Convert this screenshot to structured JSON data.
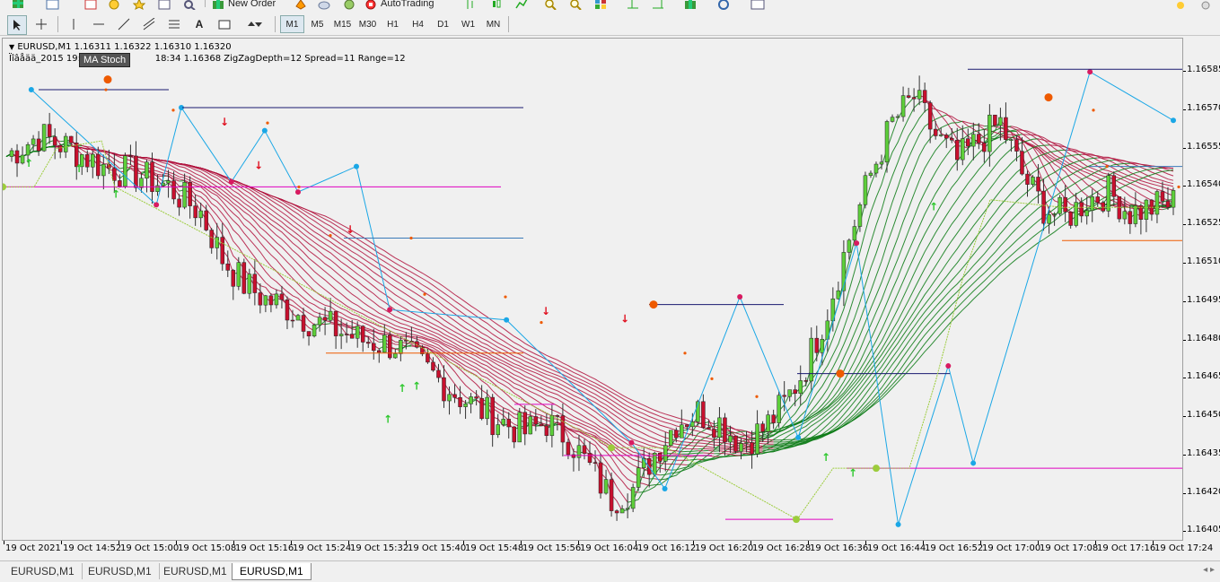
{
  "toolbar": {
    "new_order": "New Order",
    "auto_trading": "AutoTrading",
    "timeframes": [
      "M1",
      "M5",
      "M15",
      "M30",
      "H1",
      "H4",
      "D1",
      "W1",
      "MN"
    ],
    "active_timeframe": "M1"
  },
  "chart": {
    "symbol_line": "EURUSD,M1  1.16311 1.16322 1.16310 1.16320",
    "indicator_line": "Ïîâåää_2015  19:3",
    "indicator_line_b": "18:34  1.16368  ZigZagDepth=12  Spread=11  Range=12",
    "tooltip": "MA Stoch"
  },
  "chart_data": {
    "type": "candlestick",
    "symbol": "EURUSD",
    "timeframe": "M1",
    "ohlc_last": {
      "open": 1.16311,
      "high": 1.16322,
      "low": 1.1631,
      "close": 1.1632
    },
    "price_ticks": [
      "1.16585",
      "1.16570",
      "1.16555",
      "1.16540",
      "1.16525",
      "1.16510",
      "1.16495",
      "1.16480",
      "1.16465",
      "1.16450",
      "1.16435",
      "1.16420",
      "1.16405"
    ],
    "time_ticks": [
      "19 Oct 2021",
      "19 Oct 14:52",
      "19 Oct 15:00",
      "19 Oct 15:08",
      "19 Oct 15:16",
      "19 Oct 15:24",
      "19 Oct 15:32",
      "19 Oct 15:40",
      "19 Oct 15:48",
      "19 Oct 15:56",
      "19 Oct 16:04",
      "19 Oct 16:12",
      "19 Oct 16:20",
      "19 Oct 16:28",
      "19 Oct 16:36",
      "19 Oct 16:44",
      "19 Oct 16:52",
      "19 Oct 17:00",
      "19 Oct 17:08",
      "19 Oct 17:16",
      "19 Oct 17:24"
    ],
    "ylim": [
      1.16402,
      1.16598
    ],
    "close_path": [
      [
        0,
        1.16552
      ],
      [
        6,
        1.1656
      ],
      [
        12,
        1.16555
      ],
      [
        18,
        1.16548
      ],
      [
        24,
        1.16545
      ],
      [
        30,
        1.1654
      ],
      [
        36,
        1.1653
      ],
      [
        40,
        1.16512
      ],
      [
        44,
        1.16502
      ],
      [
        48,
        1.16496
      ],
      [
        52,
        1.16493
      ],
      [
        56,
        1.16488
      ],
      [
        60,
        1.16485
      ],
      [
        66,
        1.1648
      ],
      [
        72,
        1.16478
      ],
      [
        78,
        1.16468
      ],
      [
        84,
        1.16458
      ],
      [
        90,
        1.1645
      ],
      [
        96,
        1.16444
      ],
      [
        100,
        1.16448
      ],
      [
        104,
        1.16442
      ],
      [
        108,
        1.1643
      ],
      [
        112,
        1.16418
      ],
      [
        116,
        1.16422
      ],
      [
        120,
        1.16436
      ],
      [
        124,
        1.16448
      ],
      [
        128,
        1.16452
      ],
      [
        132,
        1.16448
      ],
      [
        136,
        1.1644
      ],
      [
        140,
        1.16445
      ],
      [
        144,
        1.16455
      ],
      [
        148,
        1.1647
      ],
      [
        152,
        1.16492
      ],
      [
        156,
        1.1652
      ],
      [
        160,
        1.16545
      ],
      [
        164,
        1.16565
      ],
      [
        168,
        1.16575
      ],
      [
        172,
        1.1656
      ],
      [
        176,
        1.1655
      ],
      [
        180,
        1.16558
      ],
      [
        184,
        1.16565
      ],
      [
        188,
        1.16545
      ],
      [
        192,
        1.16532
      ],
      [
        196,
        1.16528
      ],
      [
        200,
        1.16535
      ],
      [
        204,
        1.16538
      ],
      [
        208,
        1.1653
      ],
      [
        212,
        1.16532
      ],
      [
        216,
        1.16534
      ]
    ],
    "colors": {
      "bull": "#5dcf3a",
      "bear": "#c8102e",
      "ribbon_green": "#0a7a14",
      "ribbon_red": "#b0103c",
      "zigzag_blue": "#1aa7e6",
      "zigzag_pink": "#d81b60",
      "orange": "#ee5a00",
      "lime": "#9ccc3c",
      "magenta": "#e000c0",
      "navy": "#1a1a70"
    }
  },
  "tabs": [
    {
      "label": "EURUSD,M1"
    },
    {
      "label": "EURUSD,M1"
    },
    {
      "label": "EURUSD,M1"
    },
    {
      "label": "EURUSD,M1"
    }
  ],
  "active_tab": 3
}
